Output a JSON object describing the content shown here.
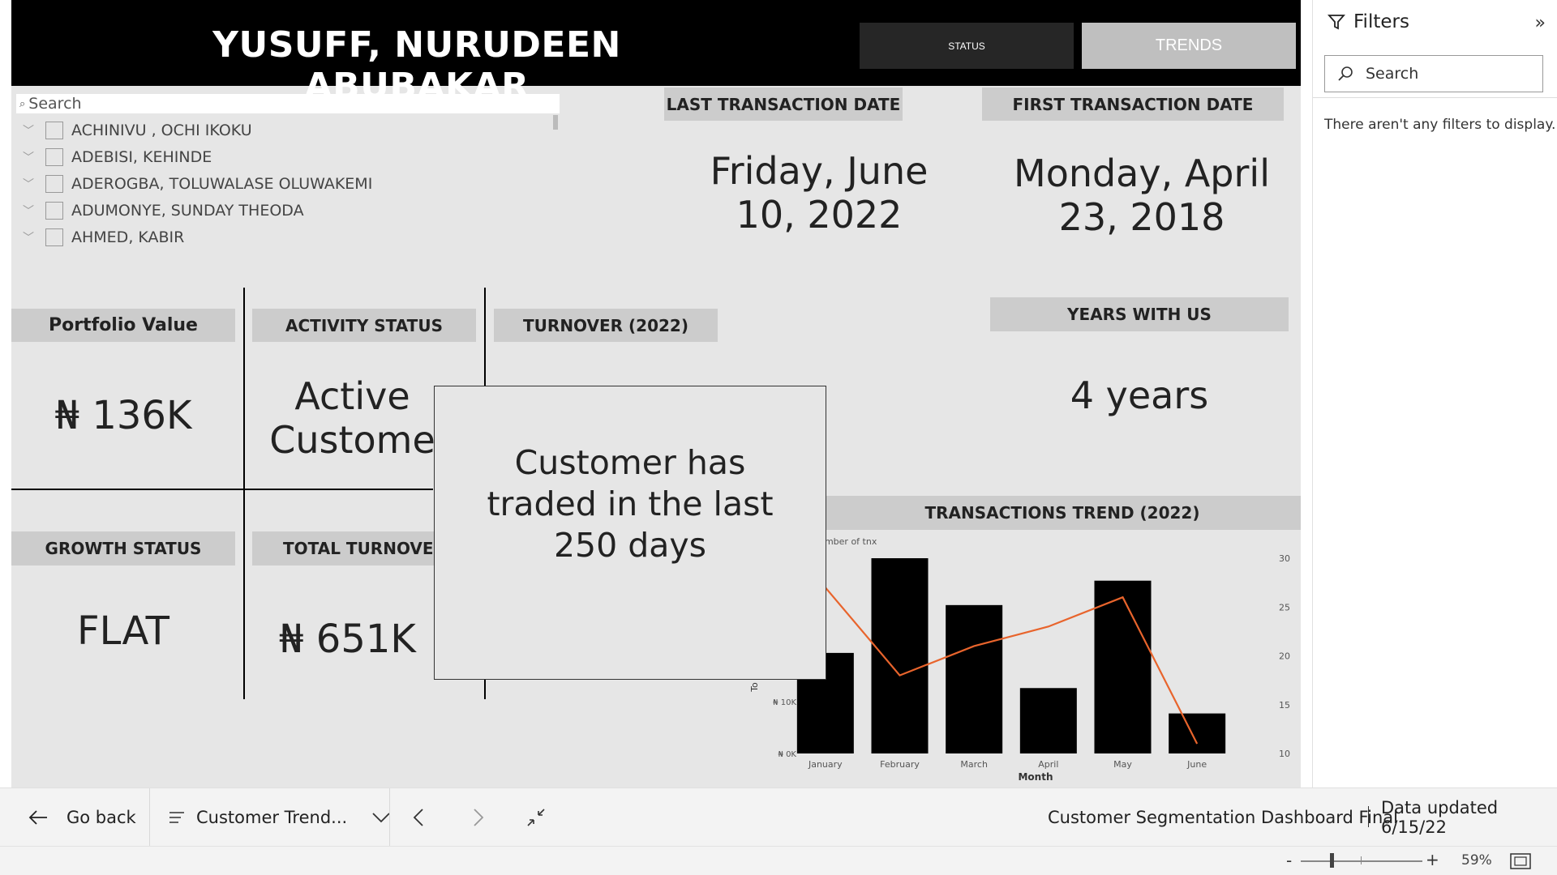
{
  "header": {
    "title": "YUSUFF, NURUDEEN ABUBAKAR",
    "status_button": "STATUS",
    "trends_button": "TRENDS"
  },
  "slicer": {
    "search_placeholder": "Search",
    "items": [
      {
        "label": "ACHINIVU , OCHI IKOKU"
      },
      {
        "label": "ADEBISI, KEHINDE"
      },
      {
        "label": "ADEROGBA, TOLUWALASE OLUWAKEMI"
      },
      {
        "label": "ADUMONYE, SUNDAY THEODA"
      },
      {
        "label": "AHMED, KABIR"
      }
    ]
  },
  "cards": {
    "last_tx_label": "LAST TRANSACTION DATE",
    "last_tx_value": "Friday, June 10, 2022",
    "first_tx_label": "FIRST TRANSACTION DATE",
    "first_tx_value": "Monday, April 23, 2018",
    "portfolio_label": "Portfolio Value",
    "portfolio_value": "₦ 136K",
    "activity_label": "ACTIVITY STATUS",
    "activity_value": "Active Custome",
    "turnover_label": "TURNOVER (2022)",
    "years_label": "YEARS WITH US",
    "years_value": "4 years",
    "growth_label": "GROWTH STATUS",
    "growth_value": "FLAT",
    "total_turnover_label": "TOTAL TURNOVER",
    "total_turnover_value": "₦ 651K"
  },
  "tooltip": {
    "text": "Customer has traded in the last 250 days"
  },
  "chart_data": {
    "type": "bar",
    "title": "TRANSACTIONS TREND (2022)",
    "xlabel": "Month",
    "ylabel_left": "To",
    "ylabel_right": "Number of tnx",
    "right_axis_title_partial": "umber of tnx",
    "categories": [
      "January",
      "February",
      "March",
      "April",
      "May",
      "June"
    ],
    "series": [
      {
        "name": "Number of tnx",
        "kind": "line",
        "color": "#e8642c",
        "values": [
          27,
          18,
          21,
          23,
          26,
          11
        ]
      }
    ],
    "bars_right_scale_values": [
      20.3,
      30,
      25.2,
      16.7,
      27.7,
      14.1
    ],
    "left_ticks": [
      "₦ 0K",
      "₦ 10K"
    ],
    "right_ticks": [
      "10",
      "15",
      "20",
      "25",
      "30"
    ],
    "right_ylim": [
      10,
      30
    ],
    "bar_color": "#000000"
  },
  "filters": {
    "title": "Filters",
    "search_placeholder": "Search",
    "empty_text": "There aren't any filters to display."
  },
  "navbar": {
    "go_back": "Go back",
    "page_name": "Customer Trend...",
    "report_name": "Customer Segmentation Dashboard Final",
    "data_updated": "Data updated 6/15/22"
  },
  "statusbar": {
    "zoom": "59%",
    "zoom_minus": "-",
    "zoom_plus": "+"
  }
}
